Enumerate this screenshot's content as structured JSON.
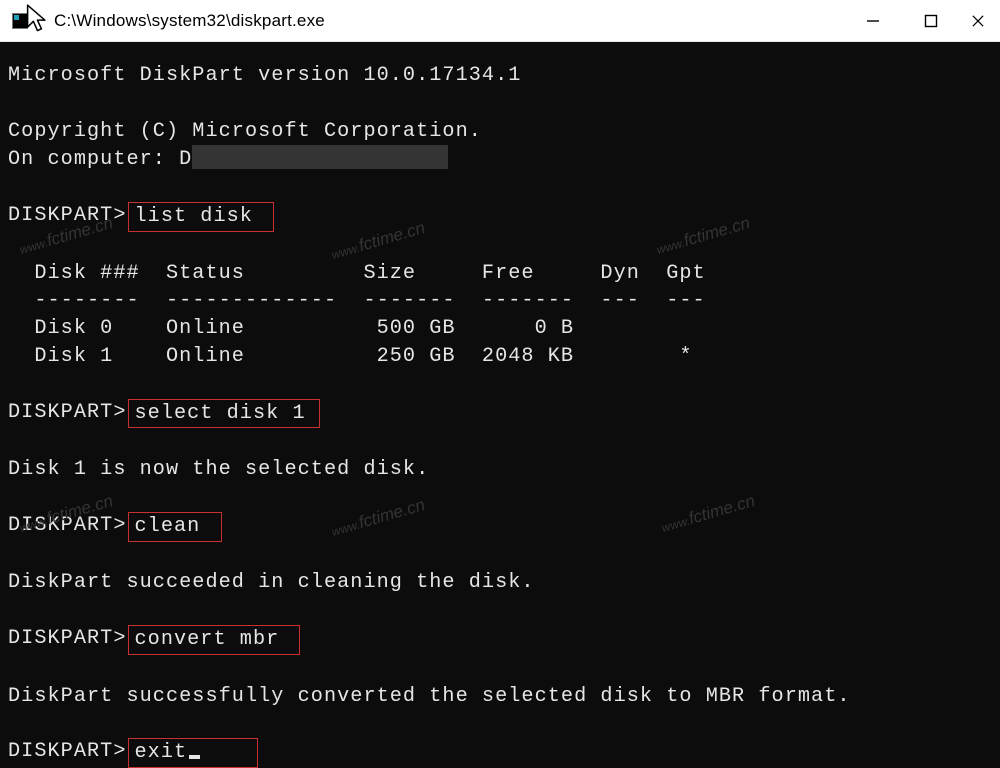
{
  "titlebar": {
    "title": "C:\\Windows\\system32\\diskpart.exe"
  },
  "terminal": {
    "version_line": "Microsoft DiskPart version 10.0.17134.1",
    "copyright_line": "Copyright (C) Microsoft Corporation.",
    "computer_prefix": "On computer: D",
    "prompt": "DISKPART>",
    "cmd_list_disk": "list disk",
    "table": {
      "header_raw": "  Disk ###  Status         Size     Free     Dyn  Gpt",
      "divider_raw": "  --------  -------------  -------  -------  ---  ---",
      "row0_raw": "  Disk 0    Online          500 GB      0 B        ",
      "row1_raw": "  Disk 1    Online          250 GB  2048 KB        *",
      "rows": [
        {
          "id": "Disk 0",
          "status": "Online",
          "size": "500 GB",
          "free": "0 B",
          "dyn": "",
          "gpt": ""
        },
        {
          "id": "Disk 1",
          "status": "Online",
          "size": "250 GB",
          "free": "2048 KB",
          "dyn": "",
          "gpt": "*"
        }
      ]
    },
    "cmd_select_disk": "select disk 1",
    "msg_selected": "Disk 1 is now the selected disk.",
    "cmd_clean": "clean",
    "msg_clean": "DiskPart succeeded in cleaning the disk.",
    "cmd_convert": "convert mbr",
    "msg_convert": "DiskPart successfully converted the selected disk to MBR format.",
    "cmd_exit": "exit"
  },
  "watermark": {
    "prefix": "www.",
    "main": "fctime.cn"
  }
}
